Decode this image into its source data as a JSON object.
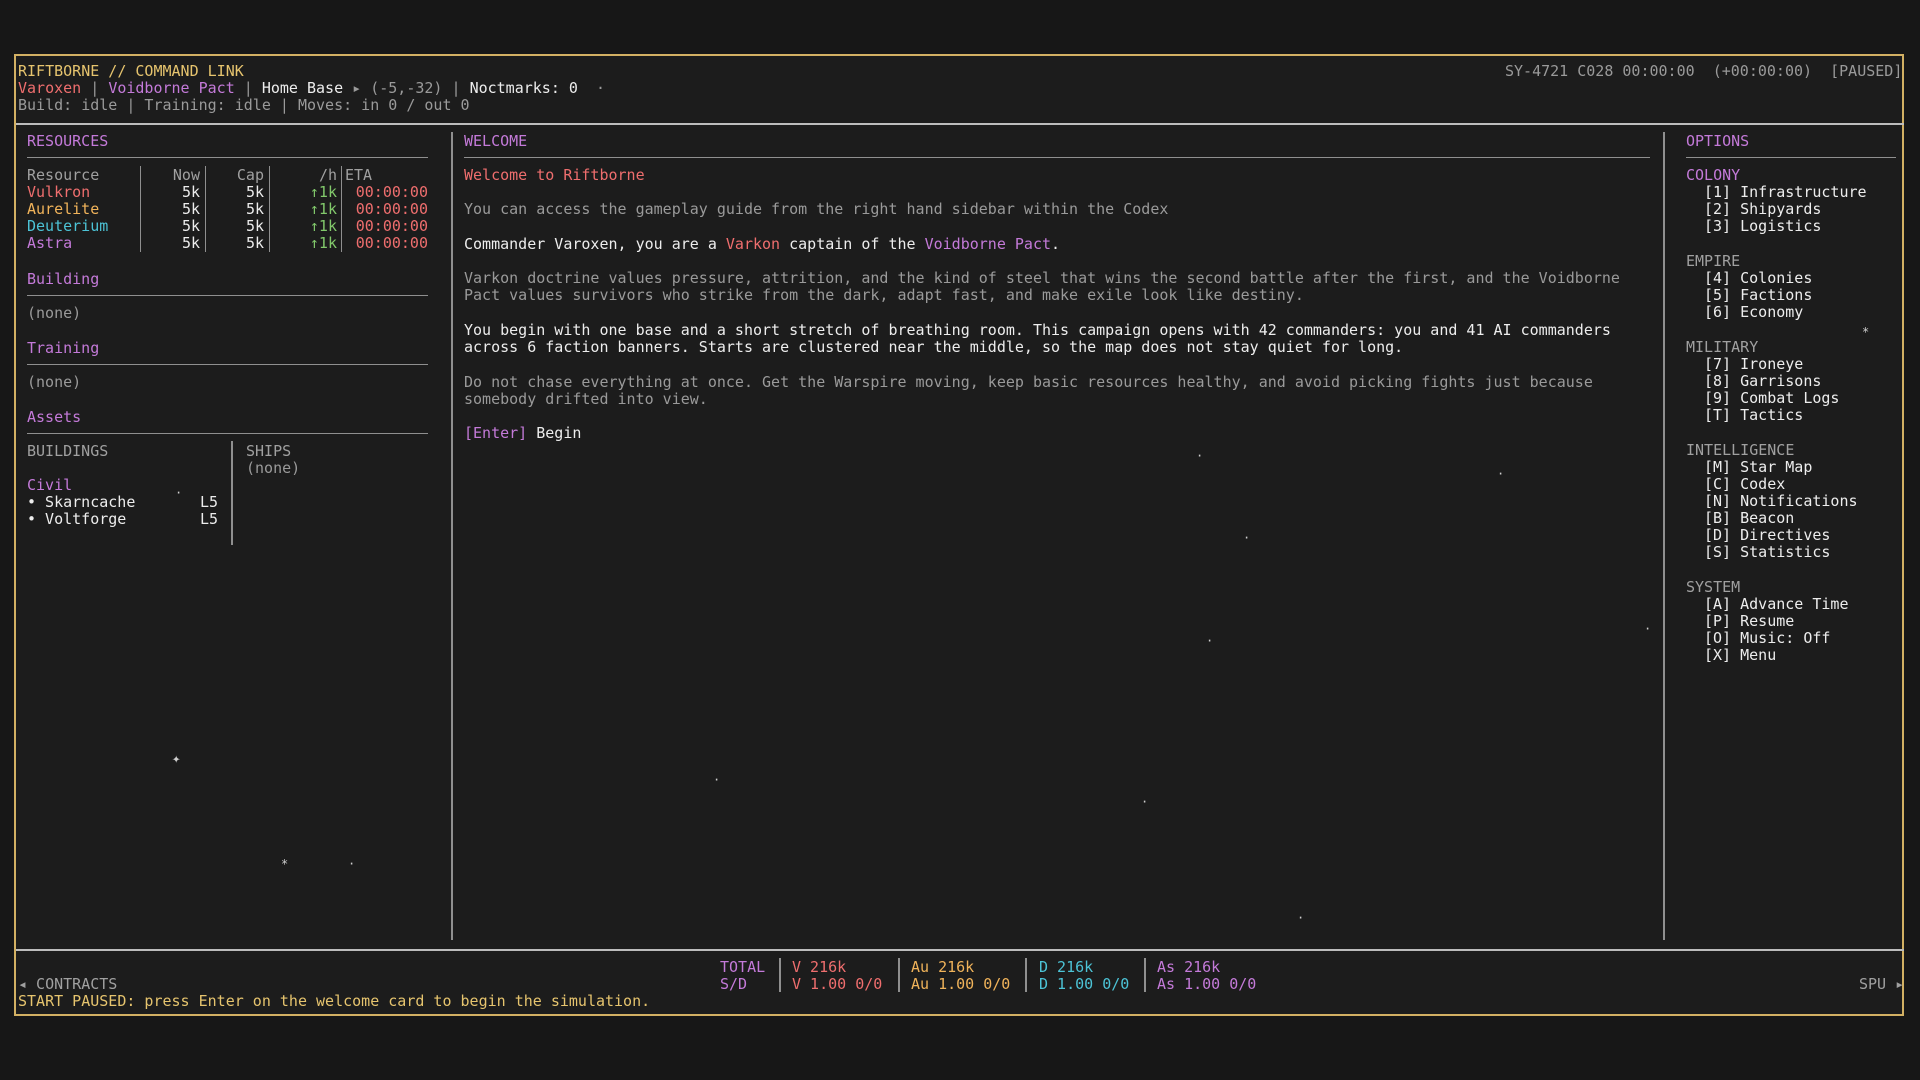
{
  "header": {
    "title": "RIFTBORNE // COMMAND LINK",
    "commander": "Varoxen",
    "faction": "Voidborne Pact",
    "base_label": "Home Base",
    "base_arrow": "▸",
    "coords": "(-5,-32)",
    "noctmarks": "Noctmarks: 0",
    "status_line": "Build: idle | Training: idle | Moves: in 0 / out 0",
    "clock": "SY-4721 C028 00:00:00",
    "offset": "(+00:00:00)",
    "paused": "[PAUSED]"
  },
  "resources": {
    "title": "RESOURCES",
    "columns": [
      "Resource",
      "Now",
      "Cap",
      "/h",
      "ETA"
    ],
    "rows": [
      {
        "name": "Vulkron",
        "now": "5k",
        "cap": "5k",
        "rate": "↑1k",
        "eta": "00:00:00",
        "color": "#ef6e6e"
      },
      {
        "name": "Aurelite",
        "now": "5k",
        "cap": "5k",
        "rate": "↑1k",
        "eta": "00:00:00",
        "color": "#f0b35a"
      },
      {
        "name": "Deuterium",
        "now": "5k",
        "cap": "5k",
        "rate": "↑1k",
        "eta": "00:00:00",
        "color": "#4cc3d6"
      },
      {
        "name": "Astra",
        "now": "5k",
        "cap": "5k",
        "rate": "↑1k",
        "eta": "00:00:00",
        "color": "#c47ad9"
      }
    ],
    "building_title": "Building",
    "building_value": "(none)",
    "training_title": "Training",
    "training_value": "(none)",
    "assets_title": "Assets",
    "buildings_header": "BUILDINGS",
    "ships_header": "SHIPS",
    "ships_value": "(none)",
    "civil_label": "Civil",
    "buildings": [
      {
        "name": "• Skarncache",
        "level": "L5"
      },
      {
        "name": "• Voltforge",
        "level": "L5"
      }
    ]
  },
  "welcome": {
    "title": "WELCOME",
    "heading": "Welcome to Riftborne",
    "guide": "You can access the gameplay guide from the right hand sidebar within the Codex",
    "intro_pre": "Commander Varoxen, you are a ",
    "intro_race": "Varkon",
    "intro_mid": " captain of the ",
    "intro_faction": "Voidborne Pact",
    "intro_post": ".",
    "doctrine": "Varkon doctrine values pressure, attrition, and the kind of steel that wins the second battle after the first, and the Voidborne\nPact values survivors who strike from the dark, adapt fast, and make exile look like destiny.",
    "begin_text": "You begin with one base and a short stretch of breathing room. This campaign opens with 42 commanders: you and 41 AI commanders\nacross 6 faction banners. Starts are clustered near the middle, so the map does not stay quiet for long.",
    "advice": "Do not chase everything at once. Get the Warspire moving, keep basic resources healthy, and avoid picking fights just because\nsomebody drifted into view.",
    "enter_key": "[Enter]",
    "enter_label": " Begin"
  },
  "options": {
    "title": "OPTIONS",
    "groups": [
      {
        "label": "COLONY",
        "items": [
          "[1] Infrastructure",
          "[2] Shipyards",
          "[3] Logistics"
        ]
      },
      {
        "label": "EMPIRE",
        "items": [
          "[4] Colonies",
          "[5] Factions",
          "[6] Economy"
        ]
      },
      {
        "label": "MILITARY",
        "items": [
          "[7] Ironeye",
          "[8] Garrisons",
          "[9] Combat Logs",
          "[T] Tactics"
        ]
      },
      {
        "label": "INTELLIGENCE",
        "items": [
          "[M] Star Map",
          "[C] Codex",
          "[N] Notifications",
          "[B] Beacon",
          "[D] Directives",
          "[S] Statistics"
        ]
      },
      {
        "label": "SYSTEM",
        "items": [
          "[A] Advance Time",
          "[P] Resume",
          "[O] Music: Off",
          "[X] Menu"
        ]
      }
    ]
  },
  "footer": {
    "contracts": "◂ CONTRACTS",
    "spu": "SPU ▸",
    "message": "START PAUSED: press Enter on the welcome card to begin the simulation.",
    "total_label": "TOTAL",
    "sd_label": "S/D",
    "totals": [
      {
        "total": "V 216k",
        "sd": "V 1.00 0/0",
        "color": "#ef6e6e"
      },
      {
        "total": "Au 216k",
        "sd": "Au 1.00 0/0",
        "color": "#f0b35a"
      },
      {
        "total": "D 216k",
        "sd": "D 1.00 0/0",
        "color": "#4cc3d6"
      },
      {
        "total": "As 216k",
        "sd": "As 1.00 0/0",
        "color": "#c47ad9"
      }
    ]
  }
}
